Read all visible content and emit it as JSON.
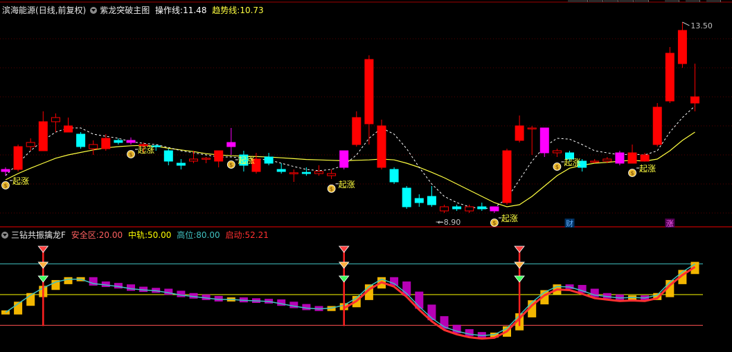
{
  "window": {
    "stock_name": "滨海能源",
    "period_label": "(日线,前复权)"
  },
  "main_panel": {
    "indicator_name": "紫龙突破主图",
    "op_line_label": "操作线:",
    "op_line_value": "11.48",
    "trend_line_label": "趋势线:",
    "trend_line_value": "10.73",
    "high_price_label": "13.50",
    "low_price_label": "8.90",
    "signal_label": "起涨",
    "signal_icon": "money-bag-icon",
    "event_badges": [
      "财",
      "涨"
    ],
    "colors": {
      "up": "#ff0000",
      "down": "#00ffff",
      "magenta": "#ff00ff",
      "trend": "#ffff40",
      "op": "#ffffff"
    }
  },
  "sub_panel": {
    "indicator_name": "三钻共振擒龙F",
    "safe_label": "安全区:",
    "safe_value": "20.00",
    "mid_label": "中轨:",
    "mid_value": "50.00",
    "high_label": "高位:",
    "high_value": "80.00",
    "start_label": "启动:",
    "start_value": "52.21",
    "diamond_icon": "diamond-icon",
    "colors": {
      "safe": "#ff5050",
      "mid": "#ffff00",
      "high": "#40c0c0",
      "start": "#ff3030"
    }
  },
  "chart_data": {
    "type": "candlestick",
    "candles": [
      {
        "o": 9.95,
        "h": 10.0,
        "l": 9.8,
        "c": 9.9,
        "k": "m"
      },
      {
        "o": 9.95,
        "h": 10.55,
        "l": 9.9,
        "c": 10.5,
        "k": "u"
      },
      {
        "o": 10.5,
        "h": 10.7,
        "l": 10.4,
        "c": 10.6,
        "k": "u"
      },
      {
        "o": 10.4,
        "h": 11.35,
        "l": 10.4,
        "c": 11.1,
        "k": "u"
      },
      {
        "o": 11.1,
        "h": 11.3,
        "l": 10.85,
        "c": 11.2,
        "k": "u"
      },
      {
        "o": 11.0,
        "h": 11.2,
        "l": 10.85,
        "c": 10.85,
        "k": "u"
      },
      {
        "o": 10.8,
        "h": 10.85,
        "l": 10.45,
        "c": 10.5,
        "k": "d"
      },
      {
        "o": 10.45,
        "h": 10.65,
        "l": 10.3,
        "c": 10.55,
        "k": "u"
      },
      {
        "o": 10.45,
        "h": 10.8,
        "l": 10.4,
        "c": 10.7,
        "k": "u"
      },
      {
        "o": 10.65,
        "h": 10.7,
        "l": 10.55,
        "c": 10.6,
        "k": "d"
      },
      {
        "o": 10.6,
        "h": 10.72,
        "l": 10.55,
        "c": 10.65,
        "k": "m"
      },
      {
        "o": 10.55,
        "h": 10.6,
        "l": 10.35,
        "c": 10.52,
        "k": "u"
      },
      {
        "o": 10.52,
        "h": 10.55,
        "l": 10.4,
        "c": 10.5,
        "k": "d"
      },
      {
        "o": 10.4,
        "h": 10.45,
        "l": 10.05,
        "c": 10.15,
        "k": "d"
      },
      {
        "o": 10.1,
        "h": 10.2,
        "l": 9.95,
        "c": 10.05,
        "k": "d"
      },
      {
        "o": 10.15,
        "h": 10.4,
        "l": 10.1,
        "c": 10.2,
        "k": "u"
      },
      {
        "o": 10.2,
        "h": 10.25,
        "l": 10.1,
        "c": 10.22,
        "k": "u"
      },
      {
        "o": 10.15,
        "h": 10.4,
        "l": 10.0,
        "c": 10.4,
        "k": "u"
      },
      {
        "o": 10.5,
        "h": 10.95,
        "l": 10.3,
        "c": 10.6,
        "k": "m"
      },
      {
        "o": 10.3,
        "h": 10.4,
        "l": 9.9,
        "c": 10.05,
        "k": "d"
      },
      {
        "o": 9.9,
        "h": 10.35,
        "l": 9.85,
        "c": 10.2,
        "k": "u"
      },
      {
        "o": 10.25,
        "h": 10.35,
        "l": 10.05,
        "c": 10.1,
        "k": "d"
      },
      {
        "o": 9.95,
        "h": 10.1,
        "l": 9.85,
        "c": 9.9,
        "k": "d"
      },
      {
        "o": 9.85,
        "h": 9.95,
        "l": 9.65,
        "c": 9.87,
        "k": "u"
      },
      {
        "o": 9.88,
        "h": 10.0,
        "l": 9.8,
        "c": 9.85,
        "k": "d"
      },
      {
        "o": 9.85,
        "h": 10.05,
        "l": 9.8,
        "c": 9.9,
        "k": "u"
      },
      {
        "o": 9.8,
        "h": 9.95,
        "l": 9.72,
        "c": 9.85,
        "k": "u"
      },
      {
        "o": 10.0,
        "h": 10.4,
        "l": 9.95,
        "c": 10.4,
        "k": "m"
      },
      {
        "o": 10.55,
        "h": 11.35,
        "l": 10.5,
        "c": 11.2,
        "k": "u"
      },
      {
        "o": 11.05,
        "h": 12.7,
        "l": 10.55,
        "c": 12.6,
        "k": "u"
      },
      {
        "o": 11.0,
        "h": 11.15,
        "l": 9.95,
        "c": 10.0,
        "k": "u"
      },
      {
        "o": 9.95,
        "h": 10.0,
        "l": 9.6,
        "c": 9.65,
        "k": "d"
      },
      {
        "o": 9.5,
        "h": 9.55,
        "l": 9.0,
        "c": 9.05,
        "k": "d"
      },
      {
        "o": 9.25,
        "h": 9.35,
        "l": 9.05,
        "c": 9.15,
        "k": "d"
      },
      {
        "o": 9.3,
        "h": 9.55,
        "l": 9.05,
        "c": 9.1,
        "k": "d"
      },
      {
        "o": 8.95,
        "h": 9.1,
        "l": 8.9,
        "c": 9.05,
        "k": "u"
      },
      {
        "o": 9.05,
        "h": 9.1,
        "l": 8.95,
        "c": 9.0,
        "k": "d"
      },
      {
        "o": 8.95,
        "h": 9.1,
        "l": 8.9,
        "c": 9.05,
        "k": "u"
      },
      {
        "o": 9.05,
        "h": 9.15,
        "l": 8.95,
        "c": 9.0,
        "k": "d"
      },
      {
        "o": 8.95,
        "h": 9.05,
        "l": 8.9,
        "c": 9.05,
        "k": "m"
      },
      {
        "o": 9.15,
        "h": 10.45,
        "l": 9.1,
        "c": 10.4,
        "k": "u"
      },
      {
        "o": 10.65,
        "h": 11.25,
        "l": 10.6,
        "c": 11.0,
        "k": "u"
      },
      {
        "o": 10.95,
        "h": 11.0,
        "l": 10.3,
        "c": 10.95,
        "k": "u"
      },
      {
        "o": 10.95,
        "h": 10.95,
        "l": 10.25,
        "c": 10.35,
        "k": "m"
      },
      {
        "o": 10.35,
        "h": 10.45,
        "l": 10.25,
        "c": 10.4,
        "k": "u"
      },
      {
        "o": 10.35,
        "h": 10.4,
        "l": 10.15,
        "c": 10.2,
        "k": "d"
      },
      {
        "o": 10.15,
        "h": 10.2,
        "l": 9.9,
        "c": 10.0,
        "k": "d"
      },
      {
        "o": 10.15,
        "h": 10.2,
        "l": 10.1,
        "c": 10.15,
        "k": "u"
      },
      {
        "o": 10.15,
        "h": 10.25,
        "l": 10.1,
        "c": 10.2,
        "k": "u"
      },
      {
        "o": 10.35,
        "h": 10.4,
        "l": 10.05,
        "c": 10.1,
        "k": "m"
      },
      {
        "o": 10.1,
        "h": 10.55,
        "l": 10.1,
        "c": 10.35,
        "k": "u"
      },
      {
        "o": 10.3,
        "h": 10.35,
        "l": 10.15,
        "c": 10.15,
        "k": "u"
      },
      {
        "o": 10.55,
        "h": 11.55,
        "l": 10.5,
        "c": 11.45,
        "k": "u"
      },
      {
        "o": 11.6,
        "h": 12.9,
        "l": 11.55,
        "c": 12.75,
        "k": "u"
      },
      {
        "o": 12.5,
        "h": 13.5,
        "l": 12.4,
        "c": 13.3,
        "k": "u"
      },
      {
        "o": 11.7,
        "h": 12.5,
        "l": 11.35,
        "c": 11.55,
        "k": "u"
      }
    ],
    "trend_line": [
      9.7,
      9.85,
      9.98,
      10.1,
      10.22,
      10.3,
      10.36,
      10.42,
      10.47,
      10.5,
      10.52,
      10.53,
      10.51,
      10.46,
      10.42,
      10.38,
      10.33,
      10.3,
      10.28,
      10.27,
      10.26,
      10.25,
      10.23,
      10.21,
      10.19,
      10.18,
      10.17,
      10.16,
      10.17,
      10.18,
      10.2,
      10.18,
      10.1,
      10.0,
      9.88,
      9.75,
      9.6,
      9.45,
      9.3,
      9.15,
      9.05,
      9.1,
      9.3,
      9.55,
      9.8,
      9.98,
      10.05,
      10.1,
      10.12,
      10.15,
      10.17,
      10.15,
      10.2,
      10.4,
      10.65,
      10.85
    ],
    "op_line": [
      9.8,
      10.1,
      10.4,
      10.65,
      10.85,
      10.95,
      10.95,
      10.8,
      10.75,
      10.7,
      10.62,
      10.58,
      10.55,
      10.48,
      10.4,
      10.35,
      10.3,
      10.25,
      10.25,
      10.22,
      10.2,
      10.18,
      10.1,
      10.02,
      9.95,
      9.92,
      9.95,
      10.05,
      10.3,
      10.7,
      10.95,
      10.8,
      10.45,
      10.0,
      9.6,
      9.3,
      9.15,
      9.05,
      9.0,
      9.03,
      9.25,
      9.7,
      10.15,
      10.5,
      10.7,
      10.68,
      10.55,
      10.4,
      10.35,
      10.3,
      10.32,
      10.3,
      10.4,
      10.85,
      11.2,
      11.48
    ],
    "signal_indices": [
      0,
      10,
      18,
      26,
      39,
      44,
      50
    ],
    "sub_indicator": {
      "levels": {
        "safe": 20,
        "mid": 50,
        "high": 80,
        "start": 52.21
      },
      "signal_indices": [
        3,
        27,
        41
      ],
      "strength": [
        5,
        5,
        4,
        4,
        4,
        3,
        3,
        3,
        3,
        3,
        3,
        3,
        3,
        3,
        3,
        3,
        3,
        3,
        3,
        3,
        3,
        3,
        3,
        3,
        3,
        3,
        3,
        3,
        3,
        3,
        3,
        3,
        3,
        3,
        3,
        3,
        3,
        3,
        3,
        3,
        3,
        3,
        3,
        3,
        3,
        3,
        3,
        3,
        3,
        3,
        3,
        3,
        3,
        3,
        3,
        3
      ]
    }
  }
}
